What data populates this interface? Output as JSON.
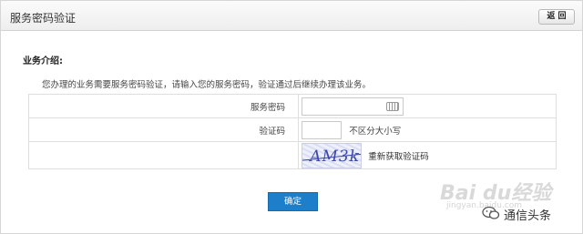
{
  "header": {
    "title": "服务密码验证",
    "back_label": "返 回"
  },
  "section": {
    "title": "业务介绍:",
    "intro": "您办理的业务需要服务密码验证，请输入您的服务密码，验证通过后继续办理该业务。"
  },
  "form": {
    "password_label": "服务密码",
    "password_value": "",
    "code_label": "验证码",
    "code_value": "",
    "code_hint": "不区分大小写",
    "captcha_text": "AM3k",
    "refresh_label": "重新获取验证码"
  },
  "actions": {
    "confirm_label": "确定"
  },
  "watermark": {
    "baidu": "Bai du经验",
    "url": "jingyan.baidu.com",
    "wechat_label": "通信头条"
  }
}
